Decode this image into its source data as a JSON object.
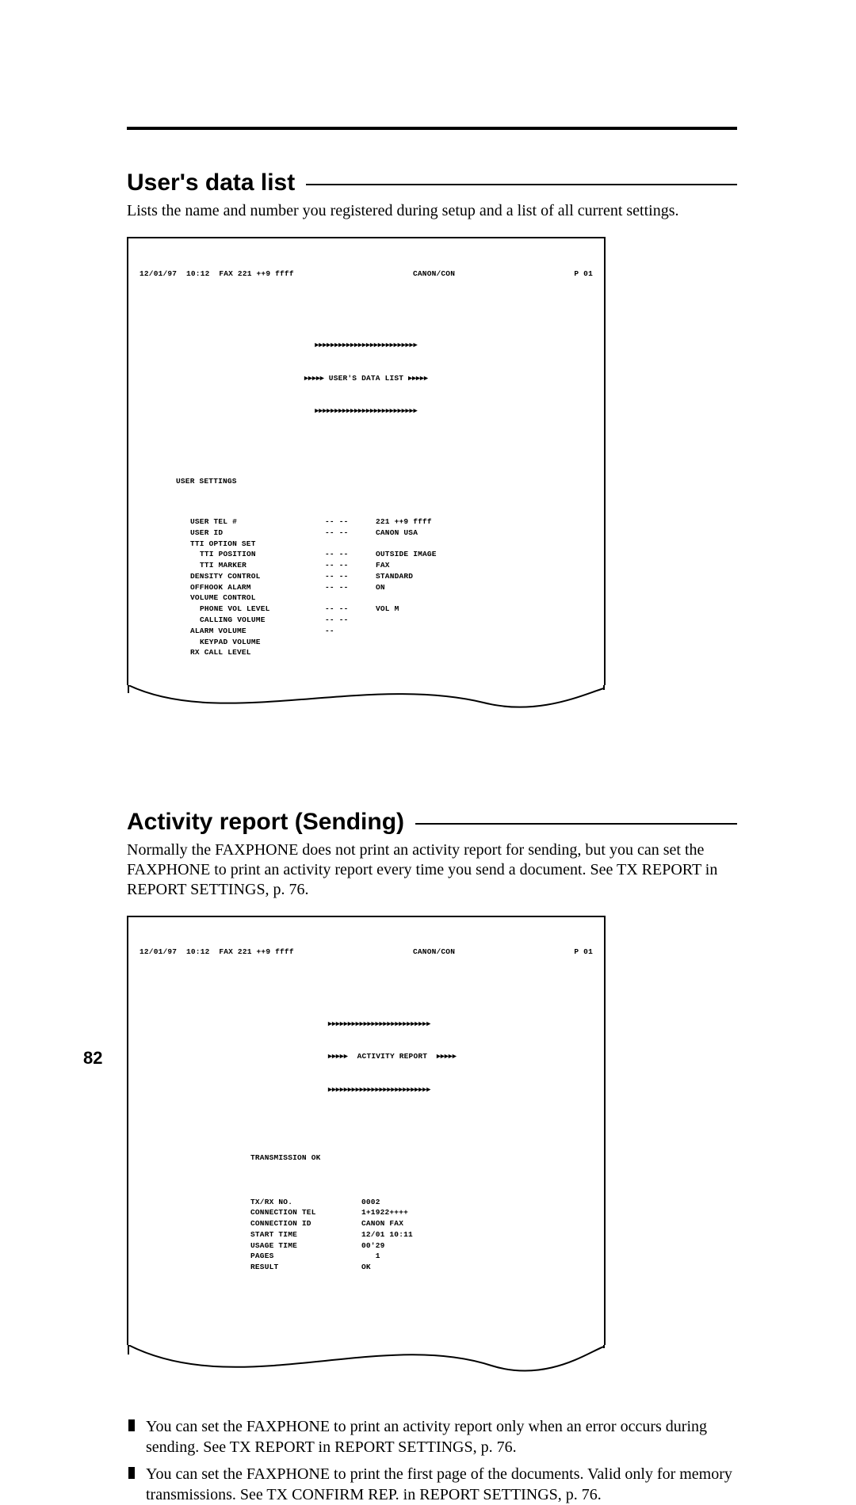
{
  "rule": "—",
  "section1": {
    "title": "User's data list",
    "intro": "Lists the name and number you registered during setup and a list of all current settings."
  },
  "printout1": {
    "hdr_left": "12/01/97  10:12  FAX 221 ++9 ffff",
    "hdr_mid": "CANON/CON",
    "hdr_right": "P 01",
    "border1": "▸▸▸▸▸▸▸▸▸▸▸▸▸▸▸▸▸▸▸▸▸▸▸▸▸▸",
    "title": "▸▸▸▸▸ USER'S DATA LIST ▸▸▸▸▸",
    "border2": "▸▸▸▸▸▸▸▸▸▸▸▸▸▸▸▸▸▸▸▸▸▸▸▸▸▸",
    "group": "USER SETTINGS",
    "rows": [
      {
        "indent": 0,
        "label": "USER TEL #",
        "dash": "-- --",
        "val": "221 ++9 ffff"
      },
      {
        "indent": 0,
        "label": "USER ID",
        "dash": "-- --",
        "val": "CANON USA"
      },
      {
        "indent": 0,
        "label": "TTI OPTION SET",
        "dash": "",
        "val": ""
      },
      {
        "indent": 1,
        "label": "TTI POSITION",
        "dash": "-- --",
        "val": "OUTSIDE IMAGE"
      },
      {
        "indent": 1,
        "label": "TTI MARKER",
        "dash": "-- --",
        "val": "FAX"
      },
      {
        "indent": 0,
        "label": "DENSITY CONTROL",
        "dash": "-- --",
        "val": "STANDARD"
      },
      {
        "indent": 0,
        "label": "OFFHOOK ALARM",
        "dash": "-- --",
        "val": "ON"
      },
      {
        "indent": 0,
        "label": "VOLUME CONTROL",
        "dash": "",
        "val": ""
      },
      {
        "indent": 1,
        "label": "PHONE VOL LEVEL",
        "dash": "-- --",
        "val": "VOL M"
      },
      {
        "indent": 1,
        "label": "CALLING VOLUME",
        "dash": "-- --",
        "val": ""
      },
      {
        "indent": 0,
        "label": "ALARM VOLUME",
        "dash": "--",
        "val": ""
      },
      {
        "indent": 1,
        "label": "KEYPAD VOLUME",
        "dash": "",
        "val": ""
      },
      {
        "indent": 0,
        "label": "RX CALL LEVEL",
        "dash": "",
        "val": ""
      }
    ]
  },
  "section2": {
    "title": "Activity report (Sending)",
    "intro": "Normally the FAXPHONE does not print an activity report for sending, but you can set the FAXPHONE to print an activity report every time you send a document. See TX REPORT in REPORT SETTINGS, p. 76."
  },
  "printout2": {
    "hdr_left": "12/01/97  10:12  FAX 221 ++9 ffff",
    "hdr_mid": "CANON/CON",
    "hdr_right": "P 01",
    "border1": "▸▸▸▸▸▸▸▸▸▸▸▸▸▸▸▸▸▸▸▸▸▸▸▸▸▸",
    "title": "▸▸▸▸▸  ACTIVITY REPORT  ▸▸▸▸▸",
    "border2": "▸▸▸▸▸▸▸▸▸▸▸▸▸▸▸▸▸▸▸▸▸▸▸▸▸▸",
    "status": "TRANSMISSION OK",
    "rows": [
      {
        "label": "TX/RX NO.",
        "val": "0002"
      },
      {
        "label": "CONNECTION TEL",
        "val": "1+1922++++"
      },
      {
        "label": "CONNECTION ID",
        "val": "CANON FAX"
      },
      {
        "label": "START TIME",
        "val": "12/01 10:11"
      },
      {
        "label": "USAGE TIME",
        "val": "00'29"
      },
      {
        "label": "PAGES",
        "val": "   1"
      },
      {
        "label": "RESULT",
        "val": "OK"
      }
    ]
  },
  "bullets": [
    "You can set the FAXPHONE to print an activity report only when an error occurs during sending. See TX REPORT in REPORT SETTINGS, p. 76.",
    "You can set the FAXPHONE to print the first page of the documents. Valid only for memory transmissions. See TX CONFIRM REP. in REPORT SETTINGS, p. 76."
  ],
  "page_number": "82"
}
